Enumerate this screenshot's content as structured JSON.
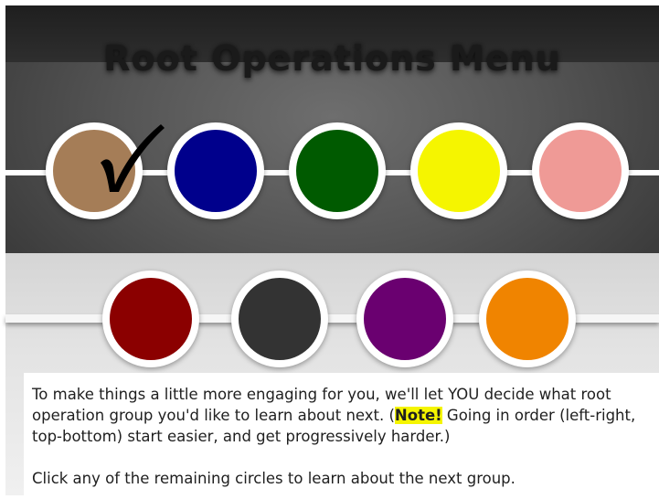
{
  "title": "Root Operations Menu",
  "circles_top": [
    {
      "name": "circle-1",
      "color": "#a57d57",
      "completed": true
    },
    {
      "name": "circle-2",
      "color": "#00008c",
      "completed": false
    },
    {
      "name": "circle-3",
      "color": "#005a00",
      "completed": false
    },
    {
      "name": "circle-4",
      "color": "#f5f500",
      "completed": false
    },
    {
      "name": "circle-5",
      "color": "#ef9a96",
      "completed": false
    }
  ],
  "circles_bottom": [
    {
      "name": "circle-6",
      "color": "#8b0000",
      "completed": false
    },
    {
      "name": "circle-7",
      "color": "#333333",
      "completed": false
    },
    {
      "name": "circle-8",
      "color": "#6a0070",
      "completed": false
    },
    {
      "name": "circle-9",
      "color": "#f08400",
      "completed": false
    }
  ],
  "instructions": {
    "part1": "To make things a little more engaging for you, we'll let YOU decide what root operation group you'd like to learn about next. (",
    "note_label": "Note!",
    "part2": " Going in order (left-right, top-bottom) start easier, and get progressively harder.)",
    "line2": "Click any of the remaining circles to learn about the next group."
  },
  "colors": {
    "note_highlight": "#f5f500",
    "checkmark": "#000000"
  }
}
